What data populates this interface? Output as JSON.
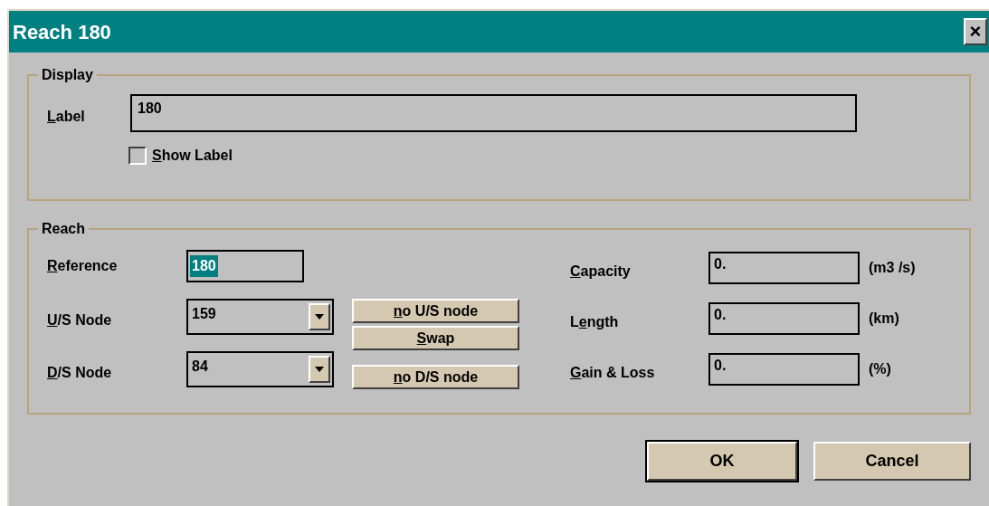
{
  "window": {
    "title": "Reach 180",
    "close": "×"
  },
  "display": {
    "title": "Display",
    "label": {
      "caption": {
        "access_key": "L",
        "rest": "abel"
      },
      "value": "180"
    },
    "show_label": {
      "caption": {
        "access_key": "S",
        "rest": "how Label"
      },
      "checked": false
    }
  },
  "reach": {
    "title": "Reach",
    "reference": {
      "caption": {
        "access_key": "R",
        "rest": "eference"
      },
      "value": "180",
      "selected": true
    },
    "nodes": [
      {
        "caption": {
          "access_key": "U",
          "rest": "/S Node"
        },
        "value": "159"
      },
      {
        "caption": {
          "access_key": "D",
          "rest": "/S Node"
        },
        "value": "84"
      }
    ],
    "node_buttons": [
      {
        "caption": {
          "access_key": "n",
          "rest": "o U/S node"
        }
      },
      {
        "caption": {
          "access_key": "S",
          "rest": "wap"
        }
      },
      {
        "caption": {
          "access_key": "n",
          "rest": "o D/S node"
        }
      }
    ],
    "properties": [
      {
        "caption": {
          "access_key": "C",
          "rest": "apacity"
        },
        "value": "0.",
        "unit": "(m3 /s)"
      },
      {
        "caption": {
          "lead": "L",
          "access_key": "e",
          "rest": "ngth"
        },
        "value": "0.",
        "unit": "(km)"
      },
      {
        "caption": {
          "access_key": "G",
          "rest": "ain & Loss"
        },
        "value": "0.",
        "unit": "(%)"
      }
    ]
  },
  "buttons": [
    {
      "label": "OK",
      "default": true
    },
    {
      "label": "Cancel",
      "default": false
    }
  ]
}
